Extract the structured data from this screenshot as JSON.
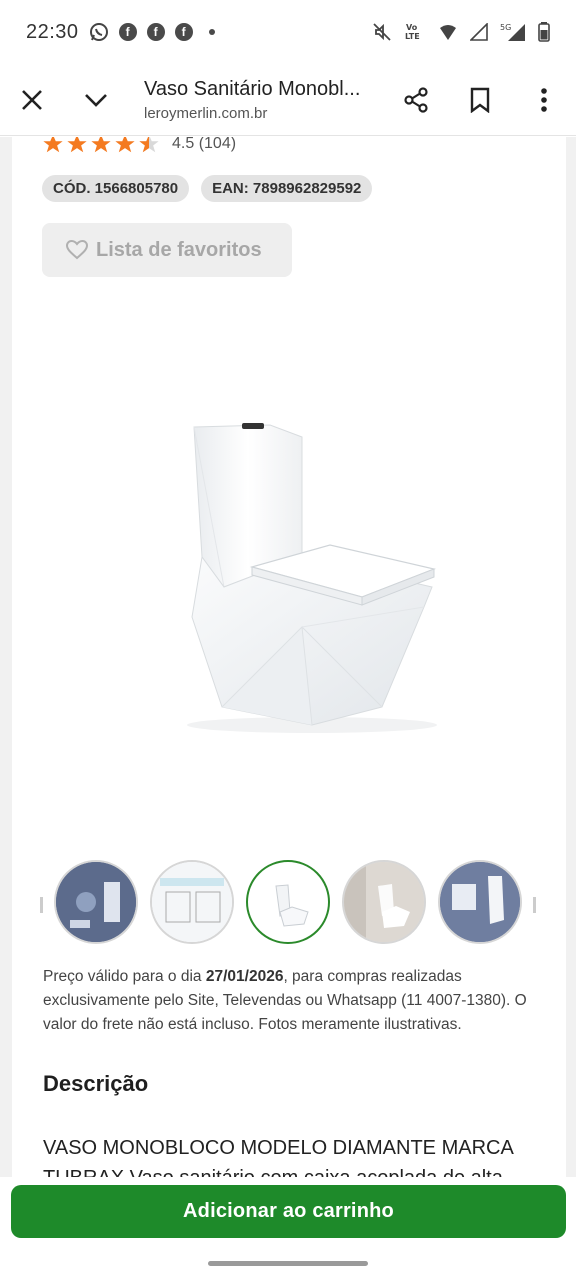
{
  "status": {
    "time": "22:30",
    "left_icons": [
      "whatsapp-icon",
      "facebook-icon",
      "facebook-icon",
      "facebook-icon"
    ],
    "right_icons": [
      "mute-icon",
      "volte-icon",
      "data-icon",
      "signal-icon",
      "signal-5g-icon",
      "battery-icon"
    ],
    "volte_text": "Vo LTE",
    "fiveg_text": "5G"
  },
  "browser": {
    "title": "Vaso Sanitário Monobl...",
    "url": "leroymerlin.com.br",
    "close_icon": "close-icon",
    "collapse_icon": "chevron-down-icon",
    "share_icon": "share-icon",
    "bookmark_icon": "bookmark-icon",
    "menu_icon": "more-vert-icon"
  },
  "product": {
    "rating_value": 4.5,
    "rating_text": "4.5 (104)",
    "star_color": "#f47a20",
    "code_chip": "CÓD. 1566805780",
    "ean_chip": "EAN: 7898962829592",
    "favorites_label": "Lista de favoritos",
    "favorites_icon": "heart-icon",
    "image_alt": "vaso-sanitario-monobloco-image"
  },
  "gallery": {
    "thumbnails": [
      "thumbnail-1",
      "thumbnail-2",
      "thumbnail-3",
      "thumbnail-4",
      "thumbnail-5"
    ],
    "active_index": 2,
    "active_color": "#2b8a2b"
  },
  "price_note": {
    "prefix": "Preço válido para o dia ",
    "date": "27/01/2026",
    "suffix": ", para compras realizadas exclusivamente pelo Site, Televendas ou Whatsapp (11 4007-1380). O valor do frete não está incluso. Fotos meramente ilustrativas."
  },
  "description": {
    "heading": "Descrição",
    "text": "VASO MONOBLOCO MODELO DIAMANTE MARCA TUBRAX Vaso sanitário com caixa acoplada de alta"
  },
  "cta": {
    "add_to_cart": "Adicionar ao carrinho",
    "color": "#1e8a2a"
  }
}
